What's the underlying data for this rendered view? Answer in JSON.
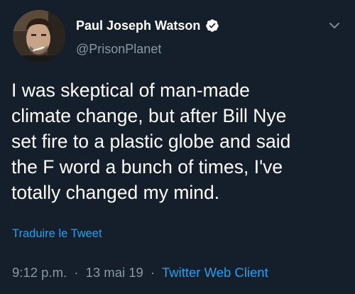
{
  "author": {
    "display_name": "Paul Joseph Watson",
    "handle": "@PrisonPlanet",
    "verified": true,
    "avatar_icon": "avatar-photo"
  },
  "tweet": {
    "text": "I was skeptical of man-made\nclimate change, but after Bill Nye\nset fire to a plastic globe and said\nthe F word a bunch of times, I've\ntotally changed my mind.",
    "translate_label": "Traduire le Tweet"
  },
  "meta": {
    "time": "9:12 p.m.",
    "separator": "·",
    "date": "13 mai 19",
    "source": "Twitter Web Client"
  },
  "colors": {
    "background": "#151f2b",
    "text": "#ffffff",
    "secondary": "#8899a6",
    "accent": "#1da1f2"
  },
  "icons": {
    "verified": "verified-badge-icon",
    "menu": "chevron-down-icon"
  }
}
